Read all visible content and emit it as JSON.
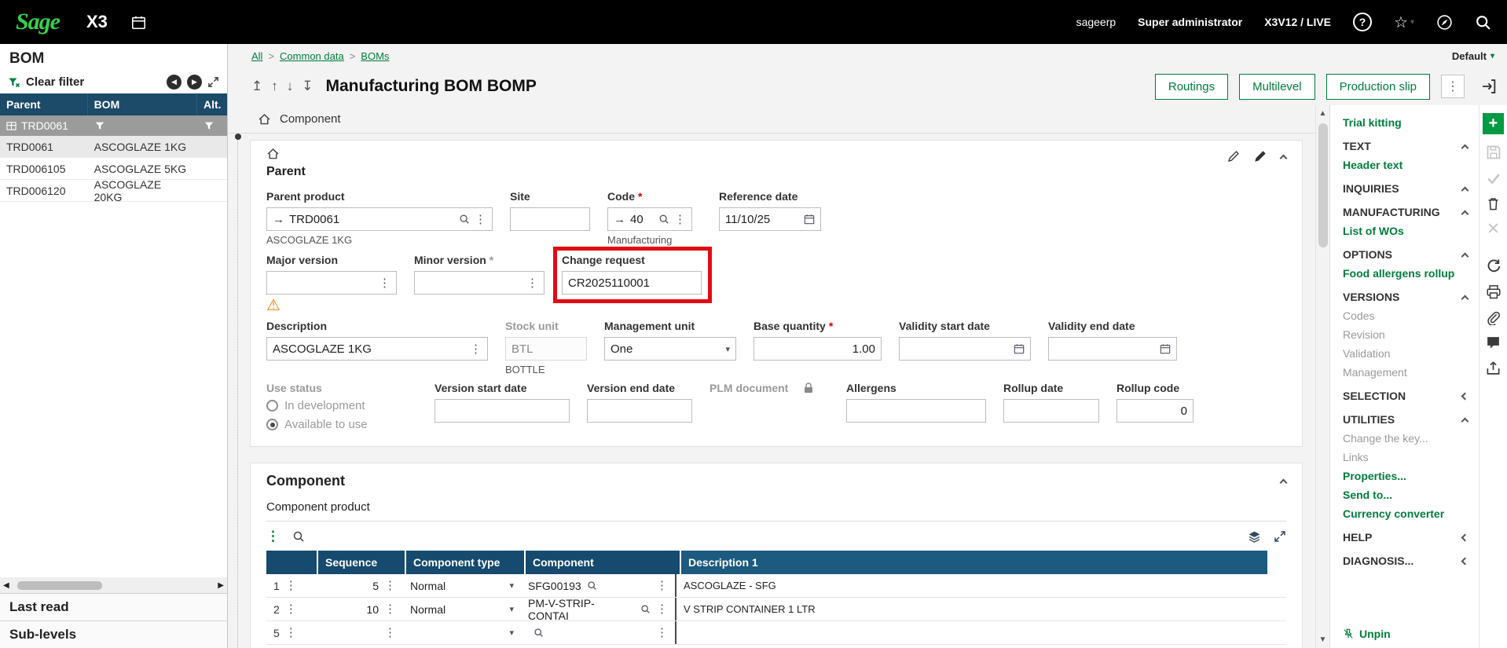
{
  "topbar": {
    "brand": "Sage",
    "product": "X3",
    "account": "sageerp",
    "user": "Super administrator",
    "endpoint": "X3V12 / LIVE"
  },
  "left_panel": {
    "title": "BOM",
    "clear_filter": "Clear filter",
    "columns": {
      "parent": "Parent",
      "bom": "BOM",
      "alt": "Alt."
    },
    "filter_value": "TRD0061",
    "rows": [
      {
        "parent": "TRD0061",
        "bom": "ASCOGLAZE 1KG"
      },
      {
        "parent": "TRD006105",
        "bom": "ASCOGLAZE 5KG"
      },
      {
        "parent": "TRD006120",
        "bom": "ASCOGLAZE 20KG"
      }
    ],
    "last_read": "Last read",
    "sub_levels": "Sub-levels"
  },
  "breadcrumb": {
    "all": "All",
    "common_data": "Common data",
    "boms": "BOMs"
  },
  "view_selector": {
    "label": "Default"
  },
  "page": {
    "title": "Manufacturing BOM BOMP",
    "routings": "Routings",
    "multilevel": "Multilevel",
    "production_slip": "Production slip",
    "tab": "Component"
  },
  "parent": {
    "section_title": "Parent",
    "parent_product": {
      "label": "Parent product",
      "value": "TRD0061",
      "description": "ASCOGLAZE 1KG"
    },
    "site": {
      "label": "Site",
      "value": ""
    },
    "code": {
      "label": "Code",
      "value": "40",
      "description": "Manufacturing"
    },
    "reference_date": {
      "label": "Reference date",
      "value": "11/10/25"
    },
    "major_version": {
      "label": "Major version",
      "value": ""
    },
    "minor_version": {
      "label": "Minor version",
      "value": ""
    },
    "change_request": {
      "label": "Change request",
      "value": "CR2025110001"
    },
    "description": {
      "label": "Description",
      "value": "ASCOGLAZE 1KG"
    },
    "stock_unit": {
      "label": "Stock unit",
      "value": "BTL",
      "description": "BOTTLE"
    },
    "management_unit": {
      "label": "Management unit",
      "value": "One"
    },
    "base_quantity": {
      "label": "Base quantity",
      "value": "1.00"
    },
    "validity_start_date": {
      "label": "Validity start date",
      "value": ""
    },
    "validity_end_date": {
      "label": "Validity end date",
      "value": ""
    },
    "use_status": {
      "label": "Use status",
      "option1": "In development",
      "option2": "Available to use"
    },
    "version_start_date": {
      "label": "Version start date",
      "value": ""
    },
    "version_end_date": {
      "label": "Version end date",
      "value": ""
    },
    "plm_document": {
      "label": "PLM document"
    },
    "allergens": {
      "label": "Allergens",
      "value": ""
    },
    "rollup_date": {
      "label": "Rollup date",
      "value": ""
    },
    "rollup_code": {
      "label": "Rollup code",
      "value": "0"
    }
  },
  "component": {
    "section_title": "Component",
    "subsection_title": "Component product",
    "columns": {
      "sequence": "Sequence",
      "component_type": "Component type",
      "component": "Component",
      "description1": "Description 1"
    },
    "rows": [
      {
        "num": "1",
        "sequence": "5",
        "component_type": "Normal",
        "component": "SFG00193",
        "description1": "ASCOGLAZE - SFG"
      },
      {
        "num": "2",
        "sequence": "10",
        "component_type": "Normal",
        "component": "PM-V-STRIP-CONTAI",
        "description1": "V STRIP CONTAINER 1 LTR"
      },
      {
        "num": "5",
        "sequence": "",
        "component_type": "",
        "component": "",
        "description1": ""
      }
    ]
  },
  "right_panel": {
    "trial_kitting": "Trial kitting",
    "text_section": "TEXT",
    "header_text": "Header text",
    "inquiries_section": "INQUIRIES",
    "manufacturing_section": "MANUFACTURING",
    "list_of_wos": "List of WOs",
    "options_section": "OPTIONS",
    "food_allergens_rollup": "Food allergens rollup",
    "versions_section": "VERSIONS",
    "codes": "Codes",
    "revision": "Revision",
    "validation": "Validation",
    "management": "Management",
    "selection_section": "SELECTION",
    "utilities_section": "UTILITIES",
    "change_the_key": "Change the key...",
    "links": "Links",
    "properties": "Properties...",
    "send_to": "Send to...",
    "currency_converter": "Currency converter",
    "help_section": "HELP",
    "diagnosis_section": "DIAGNOSIS...",
    "unpin": "Unpin"
  }
}
